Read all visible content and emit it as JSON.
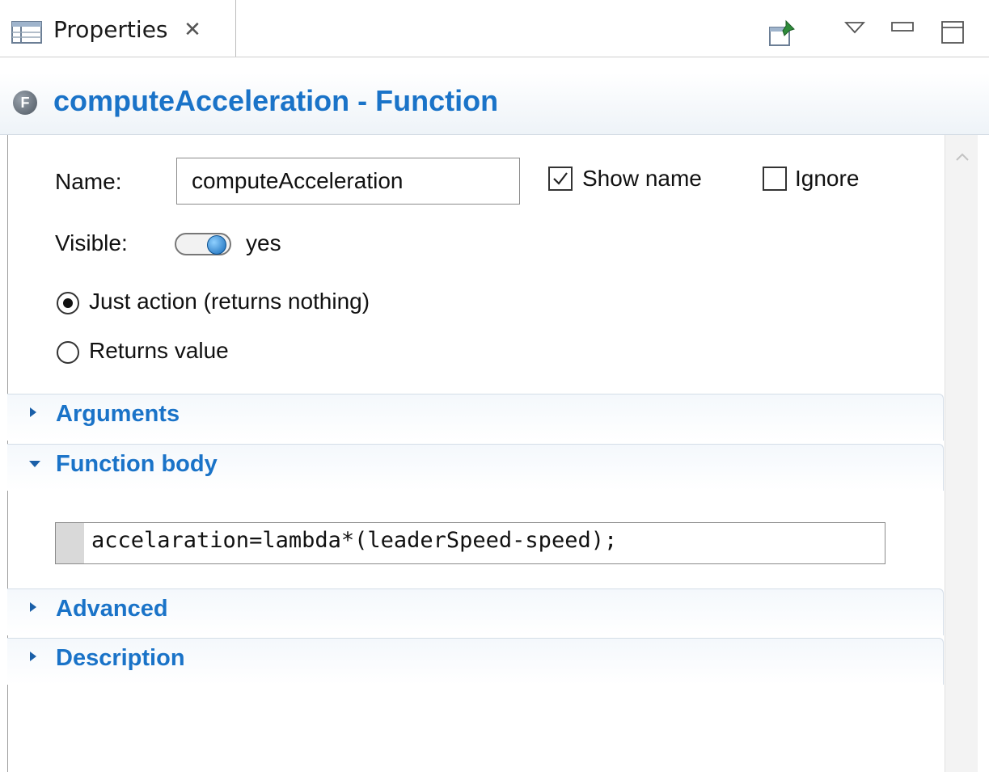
{
  "tab": {
    "title": "Properties",
    "close_glyph": "✕"
  },
  "view_toolbar": {
    "icons": [
      "pin-icon",
      "view-menu-icon",
      "minimize-icon",
      "maximize-icon"
    ]
  },
  "header": {
    "icon_letter": "F",
    "title": "computeAcceleration - Function"
  },
  "form": {
    "name_label": "Name:",
    "name_value": "computeAcceleration",
    "show_name_label": "Show name",
    "show_name_checked": true,
    "ignore_label": "Ignore",
    "ignore_checked": false,
    "visible_label": "Visible:",
    "visible_value": "yes",
    "return_options": [
      {
        "label": "Just action (returns nothing)",
        "selected": true
      },
      {
        "label": "Returns value",
        "selected": false
      }
    ]
  },
  "sections": [
    {
      "title": "Arguments",
      "expanded": false
    },
    {
      "title": "Function body",
      "expanded": true
    },
    {
      "title": "Advanced",
      "expanded": false
    },
    {
      "title": "Description",
      "expanded": false
    }
  ],
  "function_body": {
    "code": "accelaration=lambda*(leaderSpeed-speed);"
  },
  "colors": {
    "accent": "#1a73c8",
    "toggle_knob": "#1368b8"
  }
}
